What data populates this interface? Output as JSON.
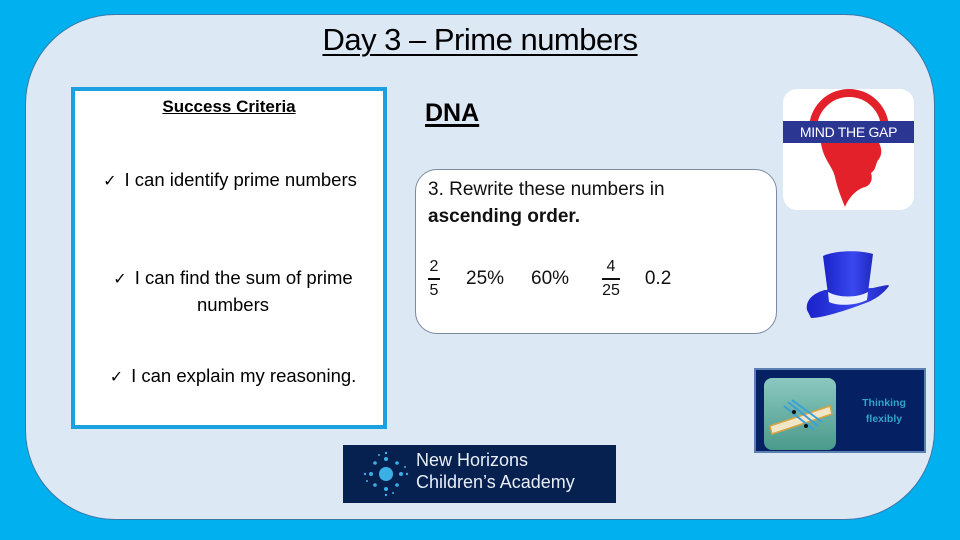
{
  "slide": {
    "title": "Day 3 – Prime numbers",
    "colors": {
      "background": "#00b0ef",
      "panel": "#dde8f5",
      "criteria_border": "#1ba1e2",
      "mind_gap_band": "#2b3592",
      "mind_gap_red": "#e3212b",
      "hat_blue": "#2a36e0",
      "logo_navy": "#062050"
    }
  },
  "success_criteria": {
    "heading": "Success Criteria",
    "tick_icon": "checkmark-icon",
    "tick_glyph": "✓",
    "items": [
      {
        "text": "I can identify prime numbers"
      },
      {
        "text": "I can find the sum of prime numbers"
      },
      {
        "text": "I can explain my reasoning."
      }
    ]
  },
  "dna": {
    "heading": "DNA",
    "question": {
      "line1": "3. Rewrite these numbers in",
      "line2": "ascending order.",
      "numbers": [
        {
          "type": "fraction",
          "numerator": "2",
          "denominator": "5"
        },
        {
          "type": "text",
          "value": "25%"
        },
        {
          "type": "text",
          "value": "60%"
        },
        {
          "type": "fraction",
          "numerator": "4",
          "denominator": "25"
        },
        {
          "type": "text",
          "value": "0.2"
        }
      ]
    }
  },
  "badges": {
    "mind_the_gap": {
      "label": "MIND THE GAP",
      "icon": "mind-the-gap-icon"
    },
    "hat": {
      "icon": "blue-top-hat-icon"
    },
    "thinking_flexibly": {
      "line1": "Thinking",
      "line2": "flexibly",
      "icon": "thinking-flexibly-icon"
    }
  },
  "footer_logo": {
    "line1": "New Horizons",
    "line2": "Children’s Academy",
    "icon": "starburst-logo-icon"
  }
}
